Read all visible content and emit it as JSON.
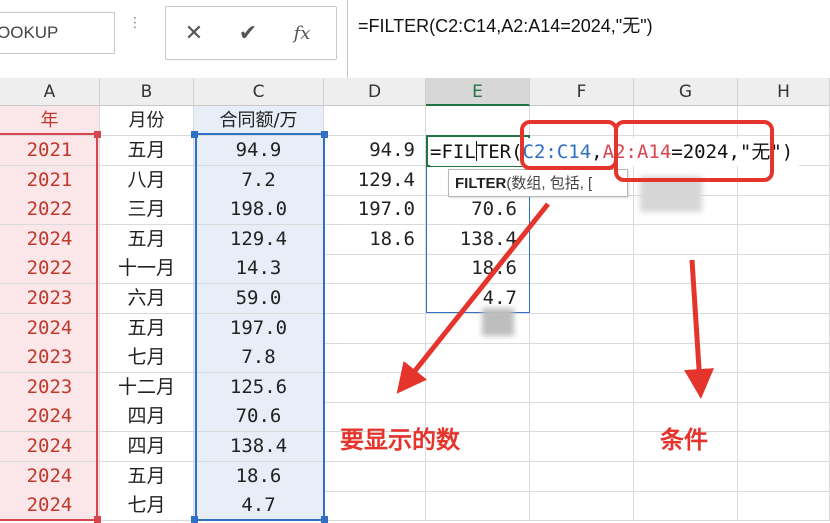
{
  "formula_bar": {
    "name_box": "OOKUP",
    "cancel_icon": "✕",
    "enter_icon": "✔",
    "fx_icon": "fx",
    "formula": "=FILTER(C2:C14,A2:A14=2024,\"无\")"
  },
  "columns": [
    "A",
    "B",
    "C",
    "D",
    "E",
    "F",
    "G",
    "H"
  ],
  "headers": {
    "A": "年",
    "B": "月份",
    "C": "合同额/万"
  },
  "rows": [
    {
      "year": "2021",
      "month": "五月",
      "amount": "94.9"
    },
    {
      "year": "2021",
      "month": "八月",
      "amount": "7.2"
    },
    {
      "year": "2022",
      "month": "三月",
      "amount": "198.0"
    },
    {
      "year": "2024",
      "month": "五月",
      "amount": "129.4"
    },
    {
      "year": "2022",
      "month": "十一月",
      "amount": "14.3"
    },
    {
      "year": "2023",
      "month": "六月",
      "amount": "59.0"
    },
    {
      "year": "2024",
      "month": "五月",
      "amount": "197.0"
    },
    {
      "year": "2023",
      "month": "七月",
      "amount": "7.8"
    },
    {
      "year": "2023",
      "month": "十二月",
      "amount": "125.6"
    },
    {
      "year": "2024",
      "month": "四月",
      "amount": "70.6"
    },
    {
      "year": "2024",
      "month": "四月",
      "amount": "138.4"
    },
    {
      "year": "2024",
      "month": "五月",
      "amount": "18.6"
    },
    {
      "year": "2024",
      "month": "七月",
      "amount": "4.7"
    }
  ],
  "column_d": [
    "94.9",
    "129.4",
    "197.0",
    "18.6"
  ],
  "column_e": [
    "",
    "",
    "70.6",
    "138.4",
    "18.6",
    "4.7"
  ],
  "edit": {
    "prefix": "=FIL",
    "prefix2": "TER(",
    "ref_c": "C2:C14",
    "comma1": ",",
    "ref_a": "A2:A14",
    "cond": "=2024,",
    "tail": "\"无\")"
  },
  "tooltip": {
    "fn": "FILTER",
    "args": "(数组, 包括, ["
  },
  "annotations": {
    "display_label": "要显示的数",
    "condition_label": "条件"
  },
  "colors": {
    "annotation_red": "#e4342c",
    "ref_blue": "#2f6fc4",
    "ref_red": "#d9454f",
    "active_green": "#217346"
  }
}
